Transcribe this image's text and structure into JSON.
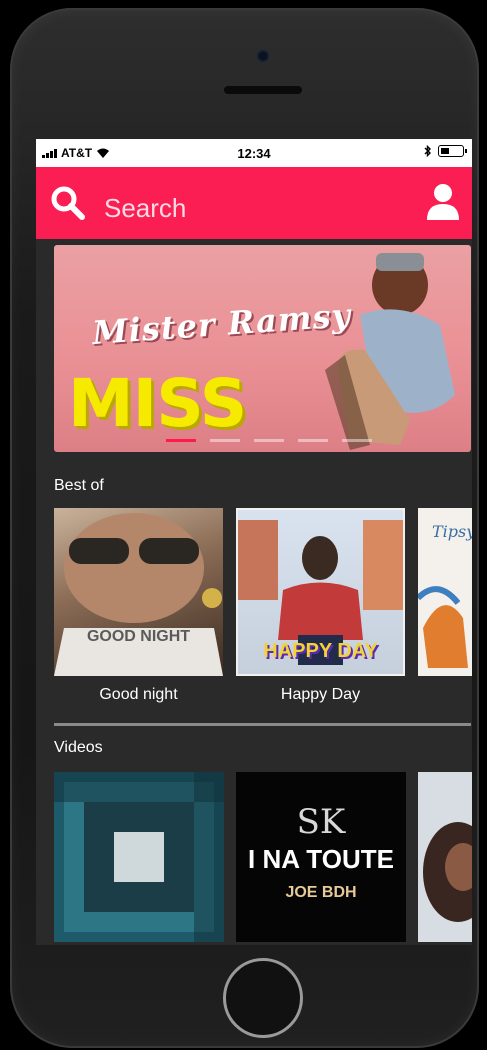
{
  "status": {
    "carrier": "AT&T",
    "time": "12:34",
    "battery_level": 0.45
  },
  "search": {
    "placeholder": "Search"
  },
  "banner": {
    "artist": "Mister Ramsy",
    "title": "MISS BUMBUM",
    "active_slide": 0,
    "slide_count": 5
  },
  "sections": {
    "best_of": {
      "title": "Best of",
      "items": [
        {
          "label": "Good night",
          "art_text": "GOOD NIGHT"
        },
        {
          "label": "Happy Day",
          "art_text": "HAPPY DAY"
        },
        {
          "label": "",
          "art_text": "Tipsy"
        }
      ]
    },
    "videos": {
      "title": "Videos",
      "items": [
        {
          "label": ""
        },
        {
          "line1": "SK",
          "line2": "I NA TOUTE",
          "line3": "JOE BDH"
        },
        {
          "label": ""
        }
      ]
    }
  },
  "colors": {
    "accent": "#fa1e52",
    "background": "#2a2a2a",
    "banner_title": "#f6ea00"
  }
}
